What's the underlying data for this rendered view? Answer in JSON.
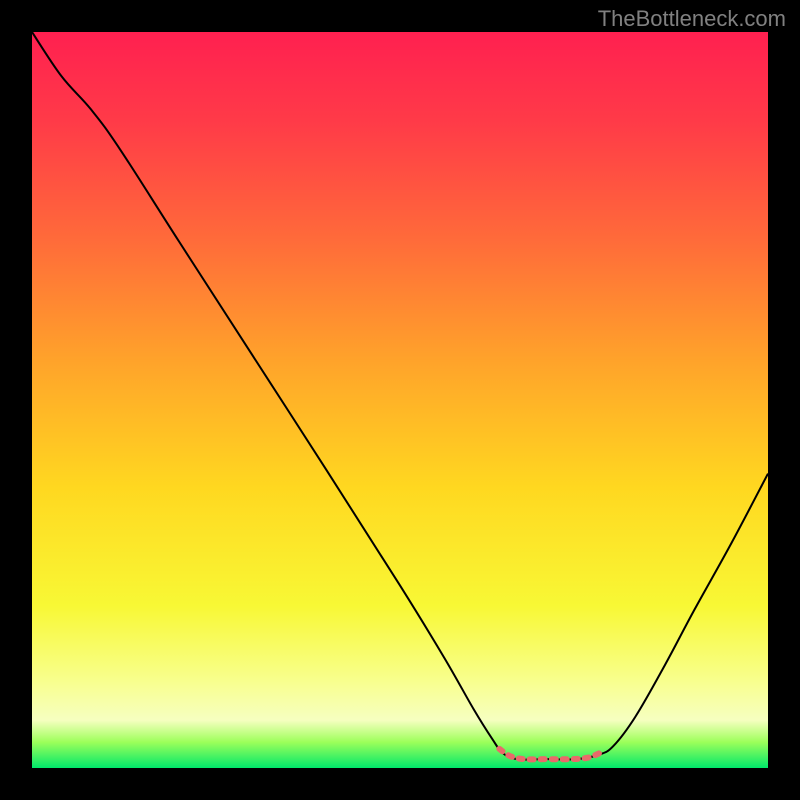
{
  "watermark": "TheBottleneck.com",
  "gradient": {
    "stops": [
      {
        "offset": 0.0,
        "color": "#ff2050"
      },
      {
        "offset": 0.12,
        "color": "#ff3a48"
      },
      {
        "offset": 0.28,
        "color": "#ff6a3a"
      },
      {
        "offset": 0.45,
        "color": "#ffa42a"
      },
      {
        "offset": 0.62,
        "color": "#ffd820"
      },
      {
        "offset": 0.78,
        "color": "#f8f835"
      },
      {
        "offset": 0.88,
        "color": "#f8ff8c"
      },
      {
        "offset": 0.935,
        "color": "#f6ffc0"
      },
      {
        "offset": 0.965,
        "color": "#9cff5a"
      },
      {
        "offset": 1.0,
        "color": "#00e86a"
      }
    ]
  },
  "chart_data": {
    "type": "line",
    "title": "",
    "xlabel": "",
    "ylabel": "",
    "xlim": [
      0,
      100
    ],
    "ylim": [
      0,
      100
    ],
    "series": [
      {
        "name": "bottleneck-curve",
        "color": "#000000",
        "points": [
          {
            "x": 0.0,
            "y": 100.0
          },
          {
            "x": 4.0,
            "y": 94.0
          },
          {
            "x": 8.0,
            "y": 89.5
          },
          {
            "x": 12.0,
            "y": 84.0
          },
          {
            "x": 20.0,
            "y": 71.5
          },
          {
            "x": 30.0,
            "y": 56.0
          },
          {
            "x": 40.0,
            "y": 40.5
          },
          {
            "x": 50.0,
            "y": 24.8
          },
          {
            "x": 56.0,
            "y": 15.0
          },
          {
            "x": 60.0,
            "y": 8.0
          },
          {
            "x": 62.5,
            "y": 4.0
          },
          {
            "x": 64.0,
            "y": 2.0
          },
          {
            "x": 66.0,
            "y": 1.2
          },
          {
            "x": 70.0,
            "y": 1.2
          },
          {
            "x": 74.0,
            "y": 1.2
          },
          {
            "x": 77.0,
            "y": 1.8
          },
          {
            "x": 79.0,
            "y": 3.0
          },
          {
            "x": 82.0,
            "y": 7.0
          },
          {
            "x": 86.0,
            "y": 14.0
          },
          {
            "x": 90.0,
            "y": 21.5
          },
          {
            "x": 95.0,
            "y": 30.5
          },
          {
            "x": 100.0,
            "y": 40.0
          }
        ]
      },
      {
        "name": "valley-highlight",
        "color": "#e96a6a",
        "points": [
          {
            "x": 63.5,
            "y": 2.6
          },
          {
            "x": 65.0,
            "y": 1.6
          },
          {
            "x": 67.0,
            "y": 1.2
          },
          {
            "x": 70.0,
            "y": 1.2
          },
          {
            "x": 73.0,
            "y": 1.2
          },
          {
            "x": 75.5,
            "y": 1.4
          },
          {
            "x": 77.5,
            "y": 2.2
          }
        ]
      }
    ]
  }
}
